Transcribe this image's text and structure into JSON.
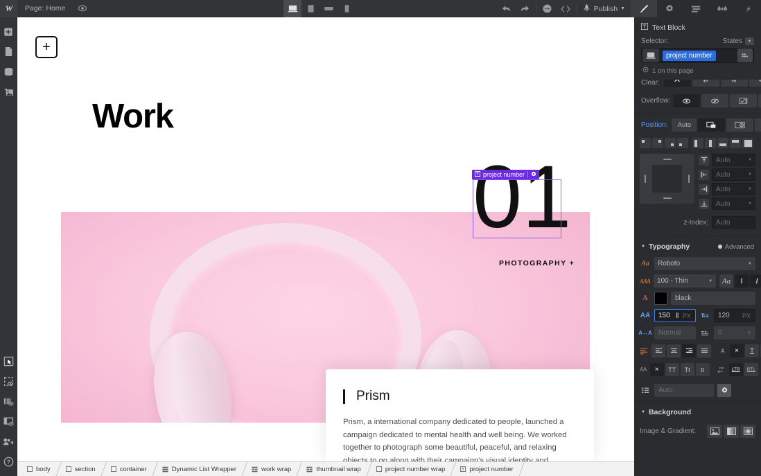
{
  "topbar": {
    "logo": "W",
    "page_label": "Page: Home",
    "eye_icon": "eye-icon",
    "devices": [
      {
        "name": "desktop",
        "active": true
      },
      {
        "name": "tablet",
        "active": false
      },
      {
        "name": "tablet-landscape",
        "active": false
      },
      {
        "name": "mobile",
        "active": false
      }
    ],
    "undo_icon": "undo-icon",
    "redo_icon": "redo-icon",
    "more_icon": "more-icon",
    "code_icon": "code-icon",
    "rocket_icon": "rocket-icon",
    "publish_label": "Publish",
    "panel_tabs": [
      {
        "name": "style-panel",
        "icon": "paintbrush-icon",
        "active": true
      },
      {
        "name": "settings-panel",
        "icon": "gear-icon",
        "active": false
      },
      {
        "name": "style-manager-panel",
        "icon": "list-icon",
        "active": false
      },
      {
        "name": "interactions-panel",
        "icon": "droplets-icon",
        "active": false
      },
      {
        "name": "effects-panel",
        "icon": "lightning-icon",
        "active": false
      }
    ]
  },
  "left_rail": {
    "top_items": [
      {
        "name": "add-elements",
        "icon": "plus-icon"
      },
      {
        "name": "pages",
        "icon": "page-icon"
      },
      {
        "name": "cms-collections",
        "icon": "database-icon"
      },
      {
        "name": "assets",
        "icon": "image-icon"
      }
    ],
    "bottom_items": [
      {
        "name": "navigator",
        "icon": "cursor-box-icon"
      },
      {
        "name": "selection-preview",
        "icon": "dashed-box-eye-icon"
      },
      {
        "name": "audit",
        "icon": "bars-eye-icon"
      },
      {
        "name": "preview",
        "icon": "panel-eye-icon"
      },
      {
        "name": "video-tutorials",
        "icon": "video-icon"
      },
      {
        "name": "help",
        "icon": "question-icon"
      }
    ]
  },
  "canvas": {
    "add_section_label": "+",
    "heading": "Work",
    "project_number": "01",
    "selection_label": "project number",
    "selection_gear_icon": "gear-icon",
    "category_tag": "PHOTOGRAPHY +",
    "card": {
      "title": "Prism",
      "body": "Prism, a international company dedicated to people, launched a campaign dedicated to mental health and well being. We worked together to photograph some beautiful, peaceful, and relaxing objects to go along with their campaign's visual identity and copywriting. My best friend is Ben Affleck."
    },
    "colors": {
      "thumbnail_pink": "#fac8dd",
      "headphone_light": "#f6dfeb",
      "selection_purple": "#6c2ae2"
    }
  },
  "breadcrumb": [
    {
      "label": "body",
      "icon": "box-icon"
    },
    {
      "label": "section",
      "icon": "box-icon"
    },
    {
      "label": "container",
      "icon": "box-icon"
    },
    {
      "label": "Dynamic List Wrapper",
      "icon": "list-icon"
    },
    {
      "label": "work wrap",
      "icon": "collection-icon"
    },
    {
      "label": "thumbnail wrap",
      "icon": "collection-icon"
    },
    {
      "label": "project number wrap",
      "icon": "box-icon"
    },
    {
      "label": "project number",
      "icon": "text-icon"
    }
  ],
  "style_panel": {
    "element_type": "Text Block",
    "element_type_icon": "text-block-icon",
    "selector_label": "Selector:",
    "states_label": "States",
    "selector_value": "project number",
    "usage_text": "1 on this page",
    "clear_label": "Clear:",
    "clear_options": [
      {
        "name": "clear-none",
        "active": true
      },
      {
        "name": "clear-left",
        "active": false
      },
      {
        "name": "clear-right",
        "active": false
      },
      {
        "name": "clear-both",
        "active": false
      }
    ],
    "overflow_label": "Overflow:",
    "overflow_options": [
      {
        "name": "overflow-visible",
        "active": true
      },
      {
        "name": "overflow-hidden",
        "active": false
      },
      {
        "name": "overflow-scroll",
        "active": false
      },
      {
        "name": "overflow-auto",
        "active": false
      }
    ],
    "position_label": "Position:",
    "position_options": [
      {
        "label": "Auto",
        "name": "position-auto",
        "active": false
      },
      {
        "label": "",
        "name": "position-relative",
        "active": true
      },
      {
        "label": "",
        "name": "position-absolute",
        "active": false
      },
      {
        "label": "",
        "name": "position-fixed",
        "active": false
      }
    ],
    "position_fields": [
      {
        "name": "top",
        "value": "Auto"
      },
      {
        "name": "left",
        "value": "Auto"
      },
      {
        "name": "right",
        "value": "Auto"
      },
      {
        "name": "bottom",
        "value": "Auto"
      }
    ],
    "zindex_label": "z-Index:",
    "zindex_value": "Auto",
    "typography": {
      "title": "Typography",
      "advanced_label": "Advanced",
      "font_family": "Roboto",
      "font_weight": "100 - Thin",
      "color_name": "black",
      "color_hex": "#000000",
      "font_size": "150",
      "font_size_unit": "PX",
      "line_height": "120",
      "line_height_unit": "PX",
      "letter_spacing": "Normal",
      "text_indent": "0",
      "columns_value": "Auto",
      "align_options": [
        {
          "name": "align-left",
          "active": false
        },
        {
          "name": "align-center",
          "active": false
        },
        {
          "name": "align-right",
          "active": true
        },
        {
          "name": "align-justify",
          "active": false
        }
      ],
      "decoration_options": [
        {
          "label": "×",
          "name": "decoration-none",
          "active": true
        },
        {
          "label": "T",
          "name": "decoration-underline",
          "active": false
        },
        {
          "label": "T",
          "name": "decoration-strikethrough",
          "active": false
        }
      ],
      "transform_options": [
        {
          "label": "×",
          "name": "transform-none",
          "active": true
        },
        {
          "label": "TT",
          "name": "transform-uppercase",
          "active": false
        },
        {
          "label": "Tt",
          "name": "transform-capitalize",
          "active": false
        },
        {
          "label": "tt",
          "name": "transform-lowercase",
          "active": false
        }
      ],
      "direction_options": [
        {
          "label": "LTR",
          "name": "direction-ltr",
          "active": true
        },
        {
          "label": "RTL",
          "name": "direction-rtl",
          "active": false
        }
      ]
    },
    "background": {
      "title": "Background",
      "image_gradient_label": "Image & Gradient:",
      "buttons": [
        {
          "name": "bg-image-button",
          "icon": "image-icon"
        },
        {
          "name": "bg-linear-gradient-button",
          "icon": "gradient-icon"
        },
        {
          "name": "bg-radial-gradient-button",
          "icon": "radial-icon"
        }
      ]
    }
  }
}
